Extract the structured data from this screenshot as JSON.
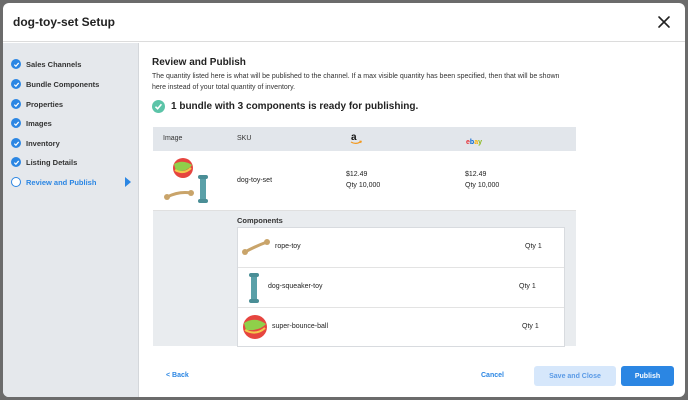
{
  "modal": {
    "title": "dog-toy-set Setup",
    "close_icon": "close-icon"
  },
  "sidebar": {
    "items": [
      {
        "label": "Sales Channels",
        "state": "done"
      },
      {
        "label": "Bundle Components",
        "state": "done"
      },
      {
        "label": "Properties",
        "state": "done"
      },
      {
        "label": "Images",
        "state": "done"
      },
      {
        "label": "Inventory",
        "state": "done"
      },
      {
        "label": "Listing Details",
        "state": "done"
      },
      {
        "label": "Review and Publish",
        "state": "active"
      }
    ]
  },
  "main": {
    "title": "Review and Publish",
    "description": "The quantity listed here is what will be published to the channel. If a max visible quantity has been specified, then that will be shown here instead of your total quantity of inventory.",
    "ready_message": "1 bundle with 3 components is ready for publishing.",
    "table": {
      "headers": {
        "image": "Image",
        "sku": "SKU",
        "channel1": "amazon",
        "channel2": "ebay"
      },
      "bundle": {
        "sku": "dog-toy-set",
        "channel1_price": "$12.49",
        "channel1_qty": "Qty 10,000",
        "channel2_price": "$12.49",
        "channel2_qty": "Qty 10,000"
      },
      "components_title": "Components",
      "components": [
        {
          "name": "rope-toy",
          "qty": "Qty 1"
        },
        {
          "name": "dog-squeaker-toy",
          "qty": "Qty 1"
        },
        {
          "name": "super-bounce-ball",
          "qty": "Qty 1"
        }
      ]
    }
  },
  "footer": {
    "back_label": "< Back",
    "cancel_label": "Cancel",
    "save_label": "Save and Close",
    "publish_label": "Publish"
  },
  "colors": {
    "accent": "#2b86e3",
    "success": "#5cc4a8",
    "sidebar_bg": "#e5e8ec"
  }
}
